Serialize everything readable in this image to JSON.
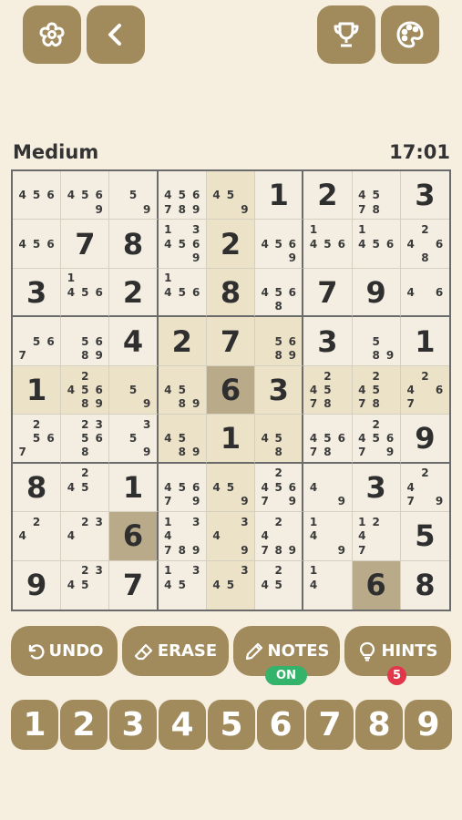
{
  "difficulty": "Medium",
  "timer": "17:01",
  "actions": {
    "undo": "UNDO",
    "erase": "ERASE",
    "notes": "NOTES",
    "notes_state": "ON",
    "hints": "HINTS",
    "hint_count": "5"
  },
  "numpad": [
    "1",
    "2",
    "3",
    "4",
    "5",
    "6",
    "7",
    "8",
    "9"
  ],
  "colors": {
    "button": "#a18b5c",
    "background": "#f6efdf",
    "on_badge": "#34b36a",
    "hint_badge": "#e3364a"
  },
  "icons": [
    "settings-flower-icon",
    "back-chevron-icon",
    "trophy-icon",
    "palette-icon",
    "undo-icon",
    "eraser-icon",
    "pencil-icon",
    "lightbulb-icon"
  ],
  "board": [
    [
      {
        "n": [
          4,
          5,
          6
        ]
      },
      {
        "n": [
          4,
          5,
          6,
          9
        ]
      },
      {
        "n": [
          5,
          9
        ]
      },
      {
        "n": [
          4,
          5,
          6,
          7,
          8,
          9
        ]
      },
      {
        "n": [
          4,
          5,
          9
        ]
      },
      {
        "v": "1"
      },
      {
        "v": "2"
      },
      {
        "n": [
          4,
          5,
          7,
          8
        ]
      },
      {
        "v": "3"
      }
    ],
    [
      {
        "n": [
          4,
          5,
          6
        ]
      },
      {
        "v": "7"
      },
      {
        "v": "8"
      },
      {
        "n": [
          1,
          3,
          4,
          5,
          6,
          9
        ]
      },
      {
        "v": "2"
      },
      {
        "n": [
          4,
          5,
          6,
          9
        ]
      },
      {
        "n": [
          1,
          4,
          5,
          6
        ]
      },
      {
        "n": [
          1,
          4,
          5,
          6
        ]
      },
      {
        "n": [
          2,
          4,
          6,
          8
        ]
      }
    ],
    [
      {
        "v": "3"
      },
      {
        "n": [
          1,
          4,
          5,
          6
        ]
      },
      {
        "v": "2"
      },
      {
        "n": [
          1,
          4,
          5,
          6
        ]
      },
      {
        "v": "8"
      },
      {
        "n": [
          4,
          5,
          6,
          8
        ]
      },
      {
        "v": "7"
      },
      {
        "v": "9"
      },
      {
        "n": [
          4,
          6
        ]
      }
    ],
    [
      {
        "n": [
          5,
          6,
          7
        ]
      },
      {
        "n": [
          5,
          6,
          8,
          9
        ]
      },
      {
        "v": "4"
      },
      {
        "v": "2"
      },
      {
        "v": "7"
      },
      {
        "n": [
          5,
          6,
          8,
          9
        ]
      },
      {
        "v": "3"
      },
      {
        "n": [
          5,
          8,
          9
        ]
      },
      {
        "v": "1"
      }
    ],
    [
      {
        "v": "1"
      },
      {
        "n": [
          2,
          4,
          5,
          6,
          8,
          9
        ]
      },
      {
        "n": [
          5,
          9
        ]
      },
      {
        "n": [
          4,
          5,
          8,
          9
        ]
      },
      {
        "v": "6"
      },
      {
        "v": "3"
      },
      {
        "n": [
          2,
          4,
          5,
          7,
          8
        ]
      },
      {
        "n": [
          2,
          4,
          5,
          7,
          8
        ]
      },
      {
        "n": [
          2,
          4,
          6,
          7
        ]
      }
    ],
    [
      {
        "n": [
          2,
          5,
          6,
          7
        ]
      },
      {
        "n": [
          2,
          3,
          5,
          6,
          8
        ]
      },
      {
        "n": [
          3,
          5,
          9
        ]
      },
      {
        "n": [
          4,
          5,
          8,
          9
        ]
      },
      {
        "v": "1"
      },
      {
        "n": [
          4,
          5,
          8
        ]
      },
      {
        "n": [
          4,
          5,
          6,
          7,
          8
        ]
      },
      {
        "n": [
          2,
          4,
          5,
          6,
          7,
          9
        ]
      },
      {
        "v": "9"
      }
    ],
    [
      {
        "v": "8"
      },
      {
        "n": [
          2,
          4,
          5
        ]
      },
      {
        "v": "1"
      },
      {
        "n": [
          4,
          5,
          6,
          7,
          9
        ]
      },
      {
        "n": [
          4,
          5,
          9
        ]
      },
      {
        "n": [
          2,
          4,
          5,
          6,
          7,
          9
        ]
      },
      {
        "n": [
          4,
          9
        ]
      },
      {
        "v": "3"
      },
      {
        "n": [
          2,
          4,
          7,
          9
        ]
      }
    ],
    [
      {
        "n": [
          2,
          4
        ]
      },
      {
        "n": [
          2,
          3,
          4
        ]
      },
      {
        "v": "6"
      },
      {
        "n": [
          1,
          3,
          4,
          7,
          8,
          9
        ]
      },
      {
        "n": [
          3,
          4,
          9
        ]
      },
      {
        "n": [
          2,
          4,
          7,
          8,
          9
        ]
      },
      {
        "n": [
          1,
          4,
          9
        ]
      },
      {
        "n": [
          1,
          2,
          4,
          7
        ]
      },
      {
        "v": "5"
      }
    ],
    [
      {
        "v": "9"
      },
      {
        "n": [
          2,
          3,
          4,
          5
        ]
      },
      {
        "v": "7"
      },
      {
        "n": [
          1,
          3,
          4,
          5
        ]
      },
      {
        "n": [
          3,
          4,
          5
        ]
      },
      {
        "n": [
          2,
          4,
          5
        ]
      },
      {
        "n": [
          1,
          4
        ]
      },
      {
        "v": "6"
      },
      {
        "v": "8"
      }
    ]
  ]
}
